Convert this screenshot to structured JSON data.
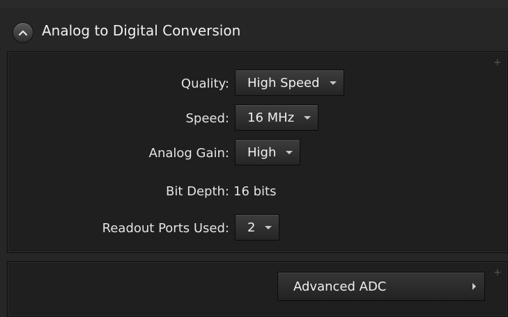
{
  "section": {
    "title": "Analog to Digital Conversion",
    "collapse_icon": "chevron-up-icon"
  },
  "fields": {
    "quality": {
      "label": "Quality:",
      "value": "High Speed"
    },
    "speed": {
      "label": "Speed:",
      "value": "16 MHz"
    },
    "analog_gain": {
      "label": "Analog Gain:",
      "value": "High"
    },
    "bit_depth": {
      "label": "Bit Depth:",
      "value": "16 bits"
    },
    "readout_ports": {
      "label": "Readout Ports Used:",
      "value": "2"
    }
  },
  "advanced": {
    "label": "Advanced ADC",
    "arrow_icon": "chevron-right-icon"
  },
  "colors": {
    "background": "#262626",
    "section_background": "#1f1f1f",
    "text": "#e4e4e4",
    "dropdown": "#303030"
  }
}
